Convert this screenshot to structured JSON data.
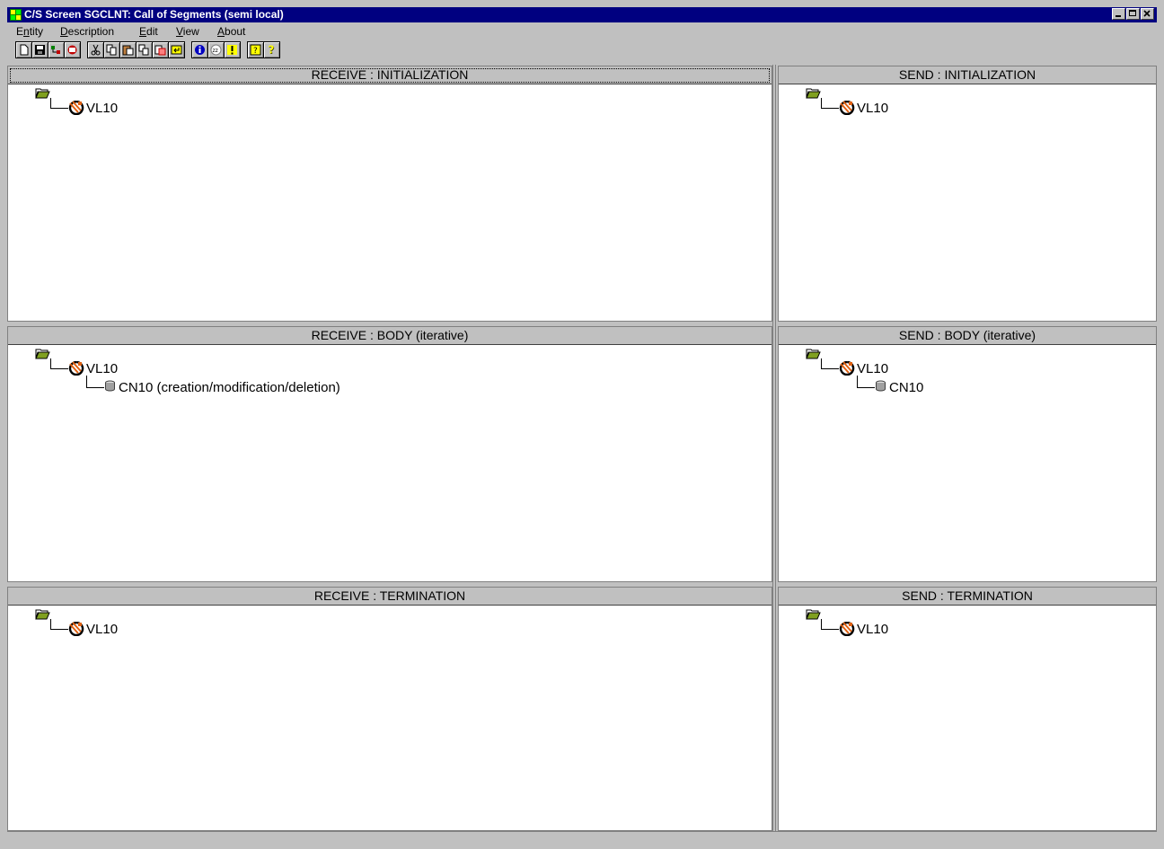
{
  "window": {
    "title": "C/S Screen SGCLNT: Call of Segments (semi local)",
    "icon": "grid-app-icon",
    "controls": [
      "minimize-icon",
      "maximize-icon",
      "close-icon"
    ]
  },
  "menu": {
    "items": [
      {
        "label": "Entity",
        "mnemonic_index": 1
      },
      {
        "label": "Description",
        "mnemonic_index": 0
      },
      {
        "label": "Edit",
        "mnemonic_index": 0
      },
      {
        "label": "View",
        "mnemonic_index": 0
      },
      {
        "label": "About",
        "mnemonic_index": 0
      }
    ]
  },
  "toolbar": {
    "buttons": [
      "new-icon",
      "save-icon",
      "tree-icon",
      "print-icon",
      "cut-icon",
      "copy-icon",
      "paste-icon",
      "duplicate-icon",
      "paste-special-icon",
      "enter-icon",
      "info-icon",
      "zzz-icon",
      "exclamation-icon",
      "help-icon",
      "context-help-icon"
    ]
  },
  "panes": {
    "receive_init": {
      "title": "RECEIVE : INITIALIZATION",
      "nodes": [
        {
          "label": "VL10",
          "icon": "segment-icon"
        }
      ]
    },
    "send_init": {
      "title": "SEND : INITIALIZATION",
      "nodes": [
        {
          "label": "VL10",
          "icon": "segment-icon"
        }
      ]
    },
    "receive_body": {
      "title": "RECEIVE : BODY (iterative)",
      "nodes": [
        {
          "label": "VL10",
          "icon": "segment-icon"
        },
        {
          "label": "CN10 (creation/modification/deletion)",
          "icon": "database-icon"
        }
      ]
    },
    "send_body": {
      "title": "SEND : BODY (iterative)",
      "nodes": [
        {
          "label": "VL10",
          "icon": "segment-icon"
        },
        {
          "label": "CN10",
          "icon": "database-icon"
        }
      ]
    },
    "receive_term": {
      "title": "RECEIVE : TERMINATION",
      "nodes": [
        {
          "label": "VL10",
          "icon": "segment-icon"
        }
      ]
    },
    "send_term": {
      "title": "SEND : TERMINATION",
      "nodes": [
        {
          "label": "VL10",
          "icon": "segment-icon"
        }
      ]
    }
  },
  "colors": {
    "titlebar": "#000080",
    "folder": "#80a020",
    "segment": "#e06010"
  }
}
